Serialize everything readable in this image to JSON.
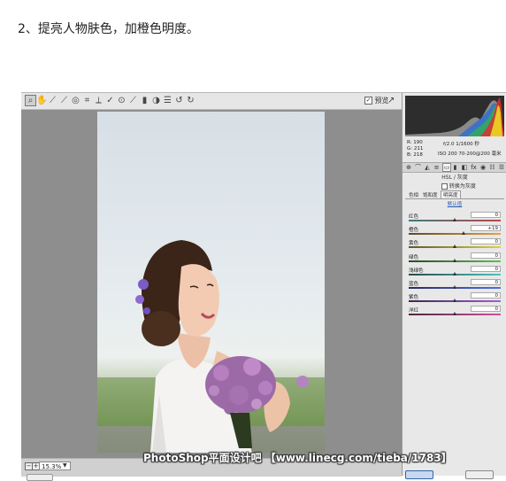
{
  "instruction": "2、提亮人物肤色，加橙色明度。",
  "toolbar": {
    "tools": [
      {
        "icon": "zoom-tool-icon",
        "glyph": "⌕",
        "active": true
      },
      {
        "icon": "hand-tool-icon",
        "glyph": "✋"
      },
      {
        "icon": "white-balance-tool-icon",
        "glyph": "⟋"
      },
      {
        "icon": "color-sampler-tool-icon",
        "glyph": "⟋"
      },
      {
        "icon": "targeted-adjustment-tool-icon",
        "glyph": "◎"
      },
      {
        "icon": "crop-tool-icon",
        "glyph": "⌗"
      },
      {
        "icon": "straighten-tool-icon",
        "glyph": "⟂"
      },
      {
        "icon": "spot-removal-tool-icon",
        "glyph": "✓"
      },
      {
        "icon": "red-eye-tool-icon",
        "glyph": "⊙"
      },
      {
        "icon": "adjustment-brush-icon",
        "glyph": "⟋"
      },
      {
        "icon": "graduated-filter-icon",
        "glyph": "▮"
      },
      {
        "icon": "radial-filter-icon",
        "glyph": "◑"
      },
      {
        "icon": "preferences-icon",
        "glyph": "☰"
      },
      {
        "icon": "rotate-left-icon",
        "glyph": "↺"
      },
      {
        "icon": "rotate-right-icon",
        "glyph": "↻"
      }
    ],
    "preview_label": "预览",
    "preview_checked": "✓",
    "fullscreen_icon": "↗"
  },
  "info": {
    "r_label": "R:",
    "r_value": "190",
    "g_label": "G:",
    "g_value": "211",
    "b_label": "B:",
    "b_value": "218",
    "camera_line1": "f/2.0  1/1600 秒",
    "camera_line2": "ISO 200  70-200@200 毫米"
  },
  "panel": {
    "tabs": [
      "⊕",
      "⌒",
      "◭",
      "≡",
      "▭",
      "▮",
      "◧",
      "fx",
      "◉",
      "☷",
      "☰"
    ],
    "active_tab": 4,
    "title": "HSL / 灰度",
    "grayscale_label": "转换为灰度",
    "subtabs": [
      "色相",
      "饱和度",
      "明亮度"
    ],
    "active_subtab": 2,
    "default_link": "默认值",
    "sliders": [
      {
        "label": "红色",
        "value": "0",
        "level": 0,
        "colors": [
          "#3f7a7a",
          "#b84a4a"
        ]
      },
      {
        "label": "橙色",
        "value": "+19",
        "level": 19,
        "colors": [
          "#5a4a2a",
          "#e8a040"
        ]
      },
      {
        "label": "黄色",
        "value": "0",
        "level": 0,
        "colors": [
          "#5a5a2a",
          "#e0d040"
        ]
      },
      {
        "label": "绿色",
        "value": "0",
        "level": 0,
        "colors": [
          "#2a4a2a",
          "#60c050"
        ]
      },
      {
        "label": "浅绿色",
        "value": "0",
        "level": 0,
        "colors": [
          "#2a4a4a",
          "#50c0c0"
        ]
      },
      {
        "label": "蓝色",
        "value": "0",
        "level": 0,
        "colors": [
          "#2a2a5a",
          "#5070e0"
        ]
      },
      {
        "label": "紫色",
        "value": "0",
        "level": 0,
        "colors": [
          "#3a2a4a",
          "#a060d0"
        ]
      },
      {
        "label": "洋红",
        "value": "0",
        "level": 0,
        "colors": [
          "#4a2a3a",
          "#d050a0"
        ]
      }
    ]
  },
  "statusbar": {
    "zoom_value": "15.3%",
    "zoom_minus": "−",
    "zoom_plus": "+"
  },
  "watermark": "PhotoShop平面设计吧 【www.linecg.com/tieba/1783】"
}
